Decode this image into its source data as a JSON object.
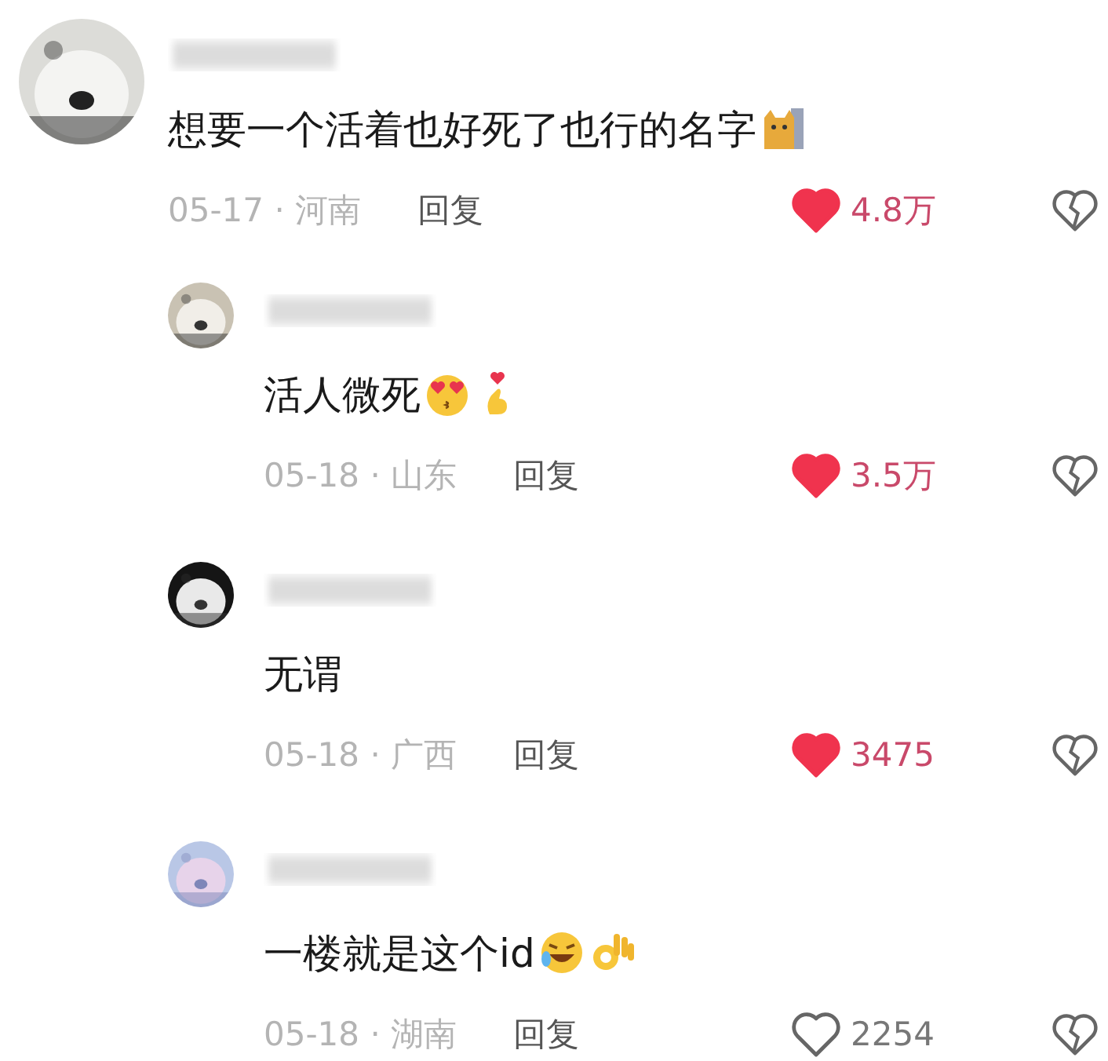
{
  "comments": [
    {
      "kind": "top",
      "avatar": {
        "kind": "picture"
      },
      "text": "想要一个活着也好死了也行的名字",
      "emojis": [
        {
          "kind": "cat"
        }
      ],
      "meta": "05-17 · 河南",
      "reply": "回复",
      "likes": "4.8万",
      "liked": true
    },
    {
      "kind": "reply",
      "avatar": {
        "kind": "picture"
      },
      "text": "活人微死",
      "emojis": [
        {
          "kind": "heart-eyes"
        },
        {
          "kind": "finger-heart"
        }
      ],
      "meta": "05-18 · 山东",
      "reply": "回复",
      "likes": "3.5万",
      "liked": true
    },
    {
      "kind": "reply",
      "avatar": {
        "kind": "picture"
      },
      "text": "无谓",
      "meta": "05-18 · 广西",
      "reply": "回复",
      "likes": "3475",
      "liked": true
    },
    {
      "kind": "reply",
      "avatar": {
        "kind": "picture"
      },
      "text": "一楼就是这个id",
      "emojis": [
        {
          "kind": "laugh-cry"
        },
        {
          "kind": "ok-hand"
        }
      ],
      "meta": "05-18 · 湖南",
      "reply": "回复",
      "likes": "2254",
      "liked": false
    }
  ]
}
